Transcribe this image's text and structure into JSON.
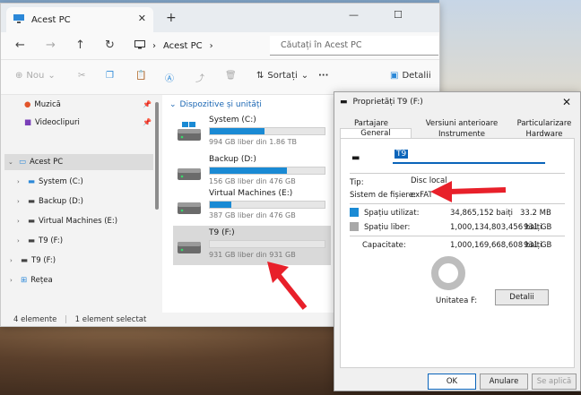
{
  "explorer": {
    "tab_title": "Acest PC",
    "address": "Acest PC",
    "search_placeholder": "Căutați în Acest PC",
    "cmd_new": "Nou",
    "cmd_sort": "Sortați",
    "cmd_details": "Detalii",
    "sidebar": {
      "music": "Muzică",
      "videos": "Videoclipuri",
      "this_pc": "Acest PC",
      "system": "System (C:)",
      "backup": "Backup (D:)",
      "vm": "Virtual Machines (E:)",
      "t9_sub": "T9 (F:)",
      "t9": "T9 (F:)",
      "network": "Rețea"
    },
    "section_title": "Dispozitive și unități",
    "drives": [
      {
        "name": "System (C:)",
        "info": "994 GB liber din 1.86 TB",
        "used_fraction": 0.48
      },
      {
        "name": "Backup (D:)",
        "info": "156 GB liber din 476 GB",
        "used_fraction": 0.67
      },
      {
        "name": "Virtual Machines (E:)",
        "info": "387 GB liber din 476 GB",
        "used_fraction": 0.19
      },
      {
        "name": "T9 (F:)",
        "info": "931 GB liber din 931 GB",
        "used_fraction": 0.0
      }
    ],
    "status_count": "4 elemente",
    "status_selected": "1 element selectat"
  },
  "dialog": {
    "title": "Proprietăți T9 (F:)",
    "tabs_row1": [
      "Partajare",
      "Versiuni anterioare",
      "Particularizare"
    ],
    "tabs_row2": [
      "General",
      "Instrumente",
      "Hardware"
    ],
    "label_name": "T9",
    "type_label": "Tip:",
    "type_value": "Disc local",
    "fs_label": "Sistem de fișiere:",
    "fs_value": "exFAT",
    "used_label": "Spațiu utilizat:",
    "used_bytes": "34,865,152 baiți",
    "used_size": "33.2 MB",
    "free_label": "Spațiu liber:",
    "free_bytes": "1,000,134,803,456 baiți",
    "free_size": "931 GB",
    "cap_label": "Capacitate:",
    "cap_bytes": "1,000,169,668,608 baiți",
    "cap_size": "931 GB",
    "drive_label": "Unitatea F:",
    "details_btn": "Detalii",
    "ok_btn": "OK",
    "cancel_btn": "Anulare",
    "apply_btn": "Se aplică",
    "used_color": "#1a8ad4",
    "free_color": "#a8a8a8"
  }
}
